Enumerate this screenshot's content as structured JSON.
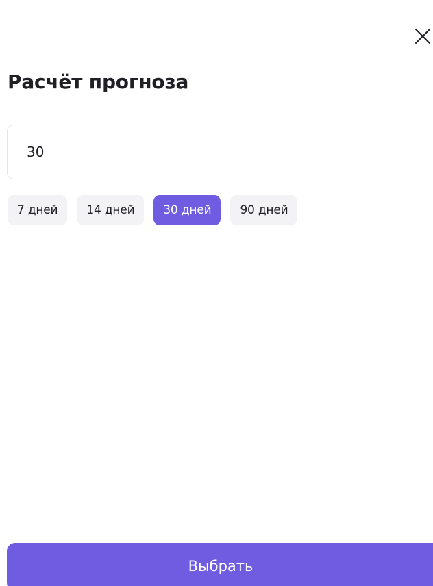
{
  "dialog": {
    "title": "Расчёт прогноза",
    "close_icon": "close-icon"
  },
  "input": {
    "value": "30",
    "placeholder": ""
  },
  "chips": [
    {
      "label": "7 дней",
      "selected": false
    },
    {
      "label": "14 дней",
      "selected": false
    },
    {
      "label": "30 дней",
      "selected": true
    },
    {
      "label": "90 дней",
      "selected": false
    }
  ],
  "footer": {
    "select_label": "Выбрать"
  },
  "colors": {
    "accent": "#6f5ce0",
    "chip_bg": "#f3f3f6",
    "text": "#1f1f24",
    "border": "#e4e4ea"
  }
}
